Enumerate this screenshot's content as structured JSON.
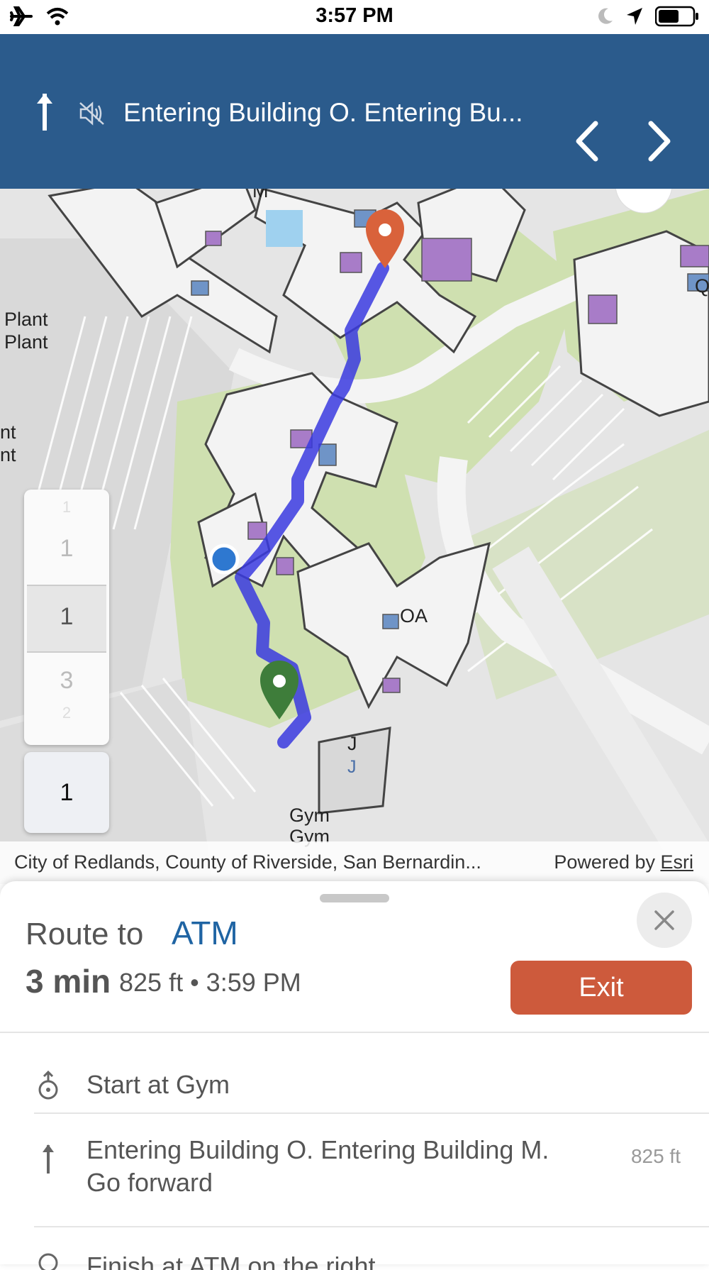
{
  "status_bar": {
    "time": "3:57 PM"
  },
  "nav": {
    "instruction": "Entering Building O. Entering Bu..."
  },
  "map": {
    "labels": {
      "m": "M",
      "plant1": "Plant",
      "plant2": "Plant",
      "nt1": "nt",
      "nt2": "nt",
      "q": "Q",
      "oa": "OA",
      "j1": "J",
      "j2": "J",
      "gym1": "Gym",
      "gym2": "Gym"
    },
    "floors": [
      "1",
      "1",
      "3",
      "2"
    ],
    "current_floor": "1",
    "attribution": "City of Redlands, County of Riverside, San Bernardin...",
    "powered_by": "Powered by",
    "esri": "Esri"
  },
  "sheet": {
    "route_to": "Route to",
    "destination": "ATM",
    "duration": "3 min",
    "details": "825 ft • 3:59 PM",
    "exit_label": "Exit",
    "steps": [
      {
        "text": "Start at Gym",
        "distance": ""
      },
      {
        "text": "Entering Building O. Entering Building M. Go forward",
        "distance": "825 ft"
      },
      {
        "text": "Finish at ATM on the right",
        "distance": ""
      }
    ]
  },
  "colors": {
    "header": "#2b5b8c",
    "route_line": "#3a3adf",
    "exit_button": "#cd5a3c",
    "destination_pin": "#d9623b",
    "start_pin": "#3e7d3a",
    "current_location": "#2e78d0",
    "link": "#1f64a3"
  }
}
